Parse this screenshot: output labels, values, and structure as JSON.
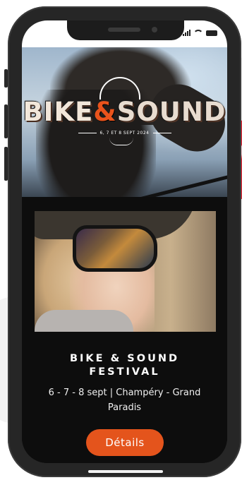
{
  "hero": {
    "logo_part1": "BIKE",
    "logo_amp": "&",
    "logo_part2": "SOUND",
    "logo_date": "6, 7 ET 8 SEPT 2024"
  },
  "event": {
    "title": "BIKE & SOUND\nFESTIVAL",
    "info": "6 - 7 - 8 sept | Champéry - Grand\nParadis",
    "details_label": "Détails"
  },
  "colors": {
    "accent": "#e4541c",
    "screen_background": "#0d0d0d",
    "sticker": "#ff2a3b"
  },
  "icons": {
    "status": [
      "cellular-signal-icon",
      "wifi-icon",
      "battery-icon"
    ]
  }
}
